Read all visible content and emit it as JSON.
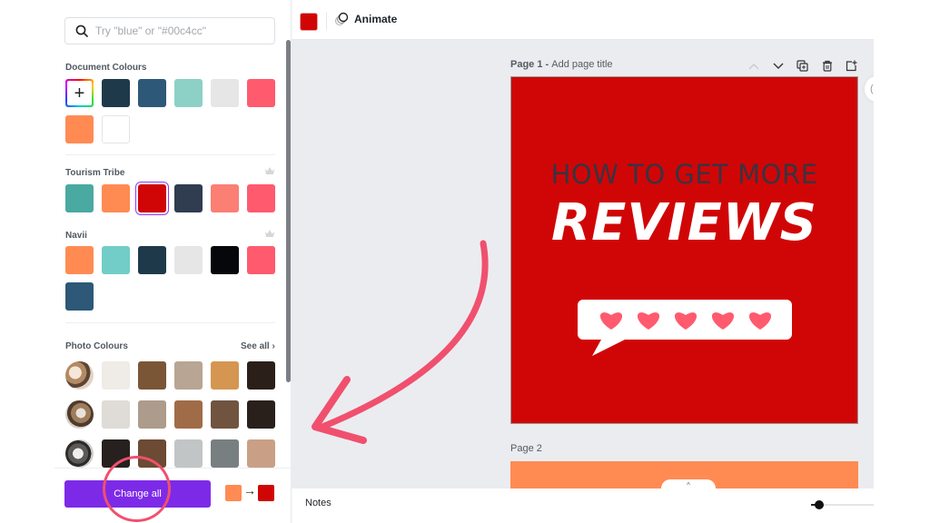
{
  "search": {
    "placeholder": "Try \"blue\" or \"#00c4cc\""
  },
  "sections": {
    "document": {
      "title": "Document Colours",
      "add_label": "+",
      "colors": [
        "#1e3a4a",
        "#2d5877",
        "#8dd0c6",
        "#e6e6e6",
        "#ff5a6e",
        "#ff8b53",
        "#ffffff"
      ]
    },
    "tourism": {
      "title": "Tourism Tribe",
      "colors": [
        "#4aa9a0",
        "#ff8b53",
        "#d00606",
        "#303c4f",
        "#fb7f73",
        "#ff5a6e"
      ],
      "selected_index": 2
    },
    "navii": {
      "title": "Navii",
      "colors": [
        "#ff8b53",
        "#72cdc8",
        "#1e3a4a",
        "#e6e6e6",
        "#05070a",
        "#ff5a6e",
        "#2d5877"
      ]
    },
    "photo": {
      "title": "Photo Colours",
      "see_all": "See all",
      "rows": [
        [
          "#efebe6",
          "#7a5637",
          "#b8a594",
          "#d59652",
          "#2b2019"
        ],
        [
          "#dfdbd7",
          "#ad9c8c",
          "#a06c48",
          "#705440",
          "#2a201b"
        ],
        [
          "#26211f",
          "#6c4a33",
          "#c2c5c5",
          "#787f80",
          "#c9a085"
        ]
      ]
    }
  },
  "footer": {
    "change_all_label": "Change all",
    "from_color": "#ff8b53",
    "to_color": "#d00606",
    "arrow": "→"
  },
  "toolbar": {
    "current_color": "#d00606",
    "animate_label": "Animate"
  },
  "canvas": {
    "page1": {
      "label_prefix": "Page 1 - ",
      "label_title": "Add page title",
      "bg_color": "#d00606",
      "headline": "HOW TO GET MORE",
      "title": "REVIEWS",
      "hearts_count": 5
    },
    "page2": {
      "label": "Page 2",
      "bg_color": "#ff8b53"
    },
    "expand_icon": "^"
  },
  "bottom": {
    "notes_label": "Notes",
    "zoom_percent": 8
  },
  "accent_color": "#7d2ae8",
  "annotation_color": "#f0506e"
}
